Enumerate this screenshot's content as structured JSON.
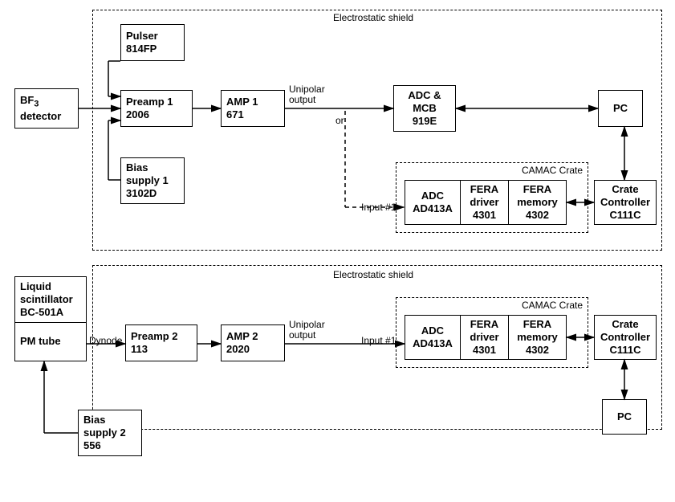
{
  "top": {
    "shield_label": "Electrostatic shield",
    "bf3": {
      "l1": "BF",
      "sub": "3",
      "l2": "detector"
    },
    "pulser": {
      "l1": "Pulser",
      "l2": "814FP"
    },
    "preamp": {
      "l1": "Preamp 1",
      "l2": "2006"
    },
    "bias": {
      "l1": "Bias",
      "l2": "supply 1",
      "l3": "3102D"
    },
    "amp": {
      "l1": "AMP 1",
      "l2": "671"
    },
    "unipolar": "Unipolar",
    "output": "output",
    "or": "or",
    "adc_mcb": {
      "l1": "ADC &",
      "l2": "MCB",
      "l3": "919E"
    },
    "pc": "PC",
    "camac_label": "CAMAC Crate",
    "input1": "Input #1",
    "adc413": {
      "l1": "ADC",
      "l2": "AD413A"
    },
    "fera_driver": {
      "l1": "FERA",
      "l2": "driver",
      "l3": "4301"
    },
    "fera_memory": {
      "l1": "FERA",
      "l2": "memory",
      "l3": "4302"
    },
    "crate_ctrl": {
      "l1": "Crate",
      "l2": "Controller",
      "l3": "C111C"
    }
  },
  "bottom": {
    "shield_label": "Electrostatic shield",
    "liquid": {
      "l1": "Liquid",
      "l2": "scintillator",
      "l3": "BC-501A"
    },
    "pm_tube": "PM tube",
    "dynode": "Dynode",
    "preamp": {
      "l1": "Preamp 2",
      "l2": "113"
    },
    "amp": {
      "l1": "AMP 2",
      "l2": "2020"
    },
    "unipolar": "Unipolar",
    "output": "output",
    "input1": "Input #1",
    "bias": {
      "l1": "Bias",
      "l2": "supply 2",
      "l3": "556"
    },
    "camac_label": "CAMAC Crate",
    "adc413": {
      "l1": "ADC",
      "l2": "AD413A"
    },
    "fera_driver": {
      "l1": "FERA",
      "l2": "driver",
      "l3": "4301"
    },
    "fera_memory": {
      "l1": "FERA",
      "l2": "memory",
      "l3": "4302"
    },
    "crate_ctrl": {
      "l1": "Crate",
      "l2": "Controller",
      "l3": "C111C"
    },
    "pc": "PC"
  }
}
